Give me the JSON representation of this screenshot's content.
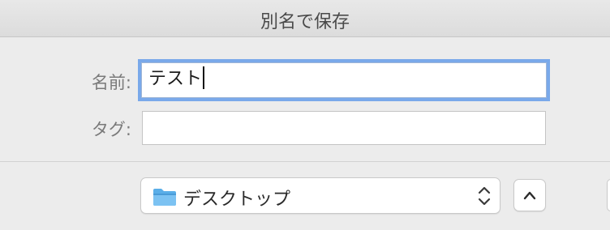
{
  "dialog": {
    "title": "別名で保存"
  },
  "form": {
    "name_label": "名前:",
    "name_value": "テスト",
    "tag_label": "タグ:",
    "tag_value": ""
  },
  "location": {
    "selected": "デスクトップ",
    "folder_icon": "folder-icon",
    "folder_color": "#5aaee8"
  },
  "controls": {
    "expand_icon": "chevron-up-icon",
    "focus_ring_color": "#7aa9ea"
  }
}
